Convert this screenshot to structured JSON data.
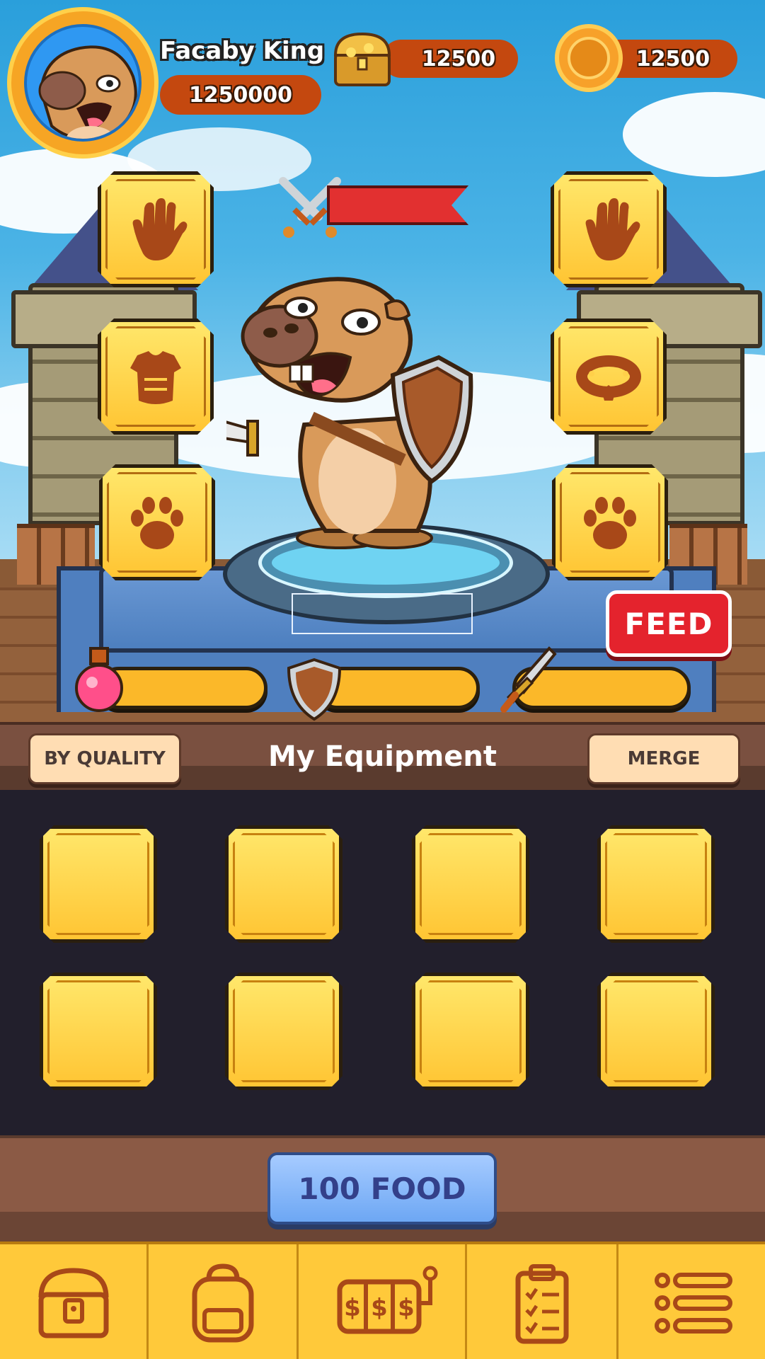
{
  "player": {
    "name": "Facaby King",
    "score": "1250000"
  },
  "currencies": {
    "chest_amount": "12500",
    "coin_amount": "12500"
  },
  "slots_left": [
    "hand-icon",
    "armor-icon",
    "paw-icon"
  ],
  "slots_right": [
    "hand-icon",
    "collar-icon",
    "paw-icon"
  ],
  "actions": {
    "feed_label": "FEED"
  },
  "stats": [
    "potion-icon",
    "shield-icon",
    "sword-icon"
  ],
  "equipment": {
    "title": "My Equipment",
    "sort_label": "BY QUALITY",
    "merge_label": "MERGE",
    "slot_count": 8
  },
  "food_button_label": "100 FOOD",
  "nav": [
    "chest-icon",
    "backpack-icon",
    "slot-machine-icon",
    "quest-clipboard-icon",
    "menu-list-icon"
  ],
  "colors": {
    "accent_yellow": "#ffc533",
    "feed_red": "#e4232d",
    "food_blue": "#8bb8fa",
    "panel_brown": "#7a5040",
    "grid_dark": "#221f2c"
  }
}
